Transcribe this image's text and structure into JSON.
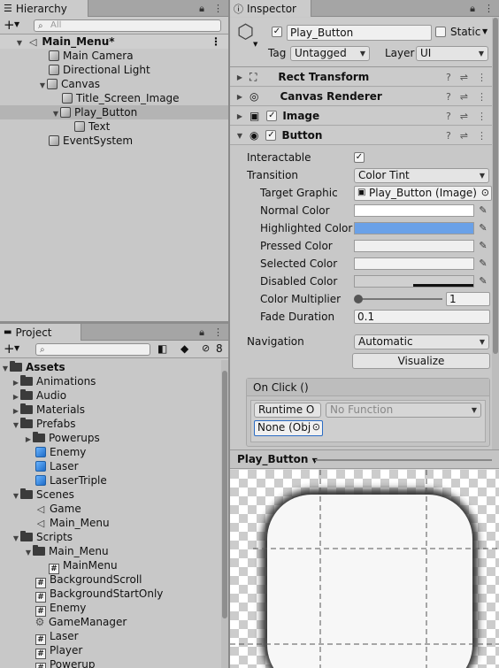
{
  "hierarchy": {
    "title": "Hierarchy",
    "search_placeholder": "All",
    "scene": "Main_Menu*",
    "items": [
      "Main Camera",
      "Directional Light",
      "Canvas",
      "Title_Screen_Image",
      "Play_Button",
      "Text",
      "EventSystem"
    ]
  },
  "project": {
    "title": "Project",
    "hidden_count": "8",
    "tree": [
      "Assets",
      "Animations",
      "Audio",
      "Materials",
      "Prefabs",
      "Powerups",
      "Enemy",
      "Laser",
      "LaserTriple",
      "Scenes",
      "Game",
      "Main_Menu",
      "Scripts",
      "Main_Menu",
      "MainMenu",
      "BackgroundScroll",
      "BackgroundStartOnly",
      "Enemy",
      "GameManager",
      "Laser",
      "Player",
      "Powerup"
    ]
  },
  "inspector": {
    "title": "Inspector",
    "object_name": "Play_Button",
    "static_label": "Static",
    "tag_label": "Tag",
    "tag_value": "Untagged",
    "layer_label": "Layer",
    "layer_value": "UI",
    "components": [
      "Rect Transform",
      "Canvas Renderer",
      "Image",
      "Button"
    ],
    "button": {
      "interactable_label": "Interactable",
      "transition_label": "Transition",
      "transition_value": "Color Tint",
      "target_graphic_label": "Target Graphic",
      "target_graphic_value": "Play_Button (Image)",
      "normal_color_label": "Normal Color",
      "highlighted_color_label": "Highlighted Color",
      "pressed_color_label": "Pressed Color",
      "selected_color_label": "Selected Color",
      "disabled_color_label": "Disabled Color",
      "color_multiplier_label": "Color Multiplier",
      "color_multiplier_value": "1",
      "fade_duration_label": "Fade Duration",
      "fade_duration_value": "0.1",
      "navigation_label": "Navigation",
      "navigation_value": "Automatic",
      "visualize_label": "Visualize",
      "onclick_label": "On Click ()",
      "runtime_value": "Runtime O",
      "function_value": "No Function",
      "object_value": "None (Obj"
    },
    "colors": {
      "normal": "#ffffff",
      "highlighted": "#6aa1e8",
      "pressed": "#efefef",
      "selected": "#f2f2f2",
      "disabled": "#d0d0d0"
    }
  },
  "preview": {
    "title": "Play_Button"
  }
}
